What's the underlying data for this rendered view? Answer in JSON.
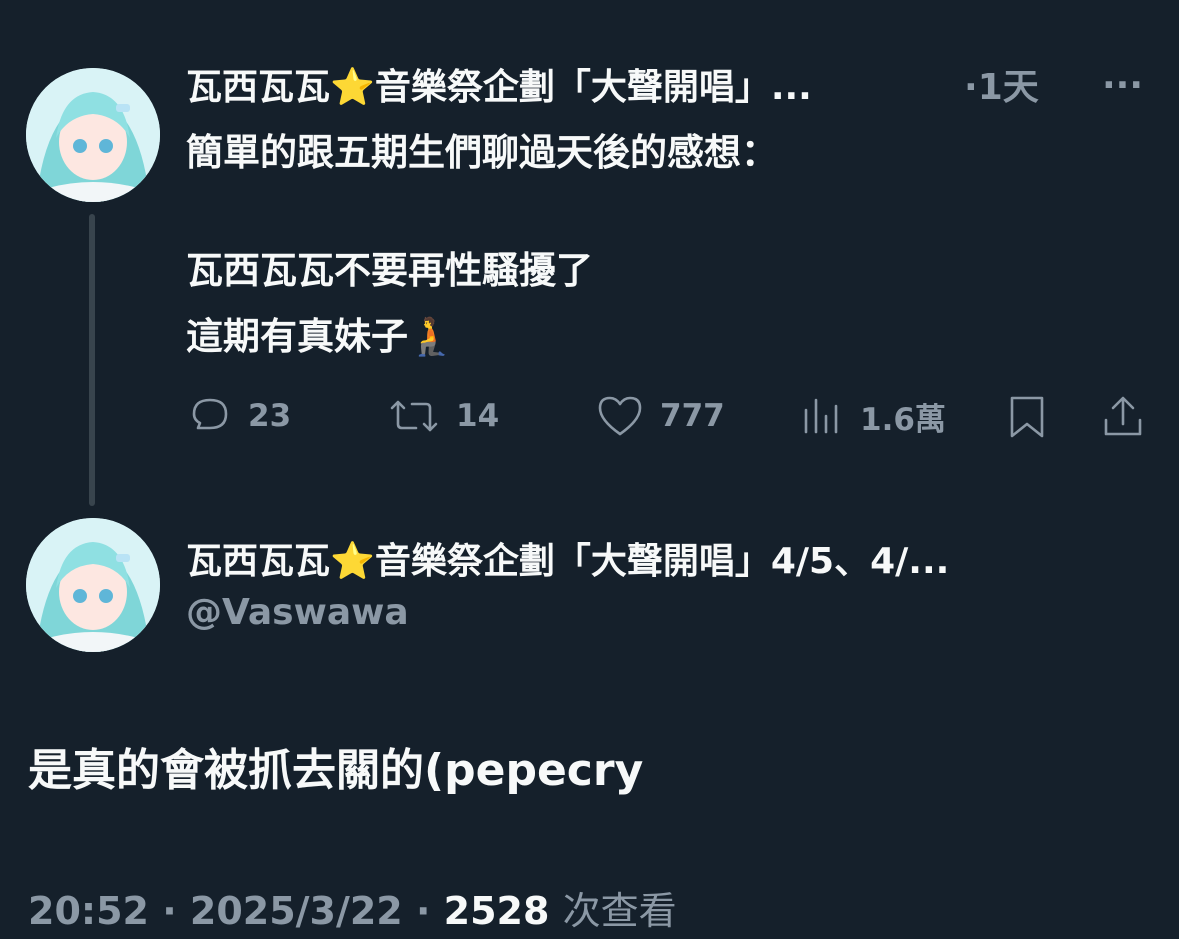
{
  "reply_tweet": {
    "display_name": "瓦西瓦瓦⭐音樂祭企劃「大聲開唱」...",
    "time_sep": "·",
    "time": "1天",
    "more": "···",
    "text_lines": [
      "簡單的跟五期生們聊過天後的感想：",
      "",
      "瓦西瓦瓦不要再性騷擾了",
      "這期有真妹子🧎"
    ],
    "actions": {
      "reply_count": "23",
      "retweet_count": "14",
      "like_count": "777",
      "view_count": "1.6萬"
    }
  },
  "main_tweet": {
    "display_name": "瓦西瓦瓦⭐音樂祭企劃「大聲開唱」4/5、4/...",
    "handle": "@Vaswawa",
    "text": "是真的會被抓去關的(pepecry",
    "time": "20:52",
    "date": "2025/3/22",
    "sep": "·",
    "view_count": "2528",
    "view_label": "次查看"
  },
  "colors": {
    "background": "#15202b",
    "text": "#f7f9f9",
    "muted": "#8b98a5",
    "thread_line": "#38444d"
  }
}
